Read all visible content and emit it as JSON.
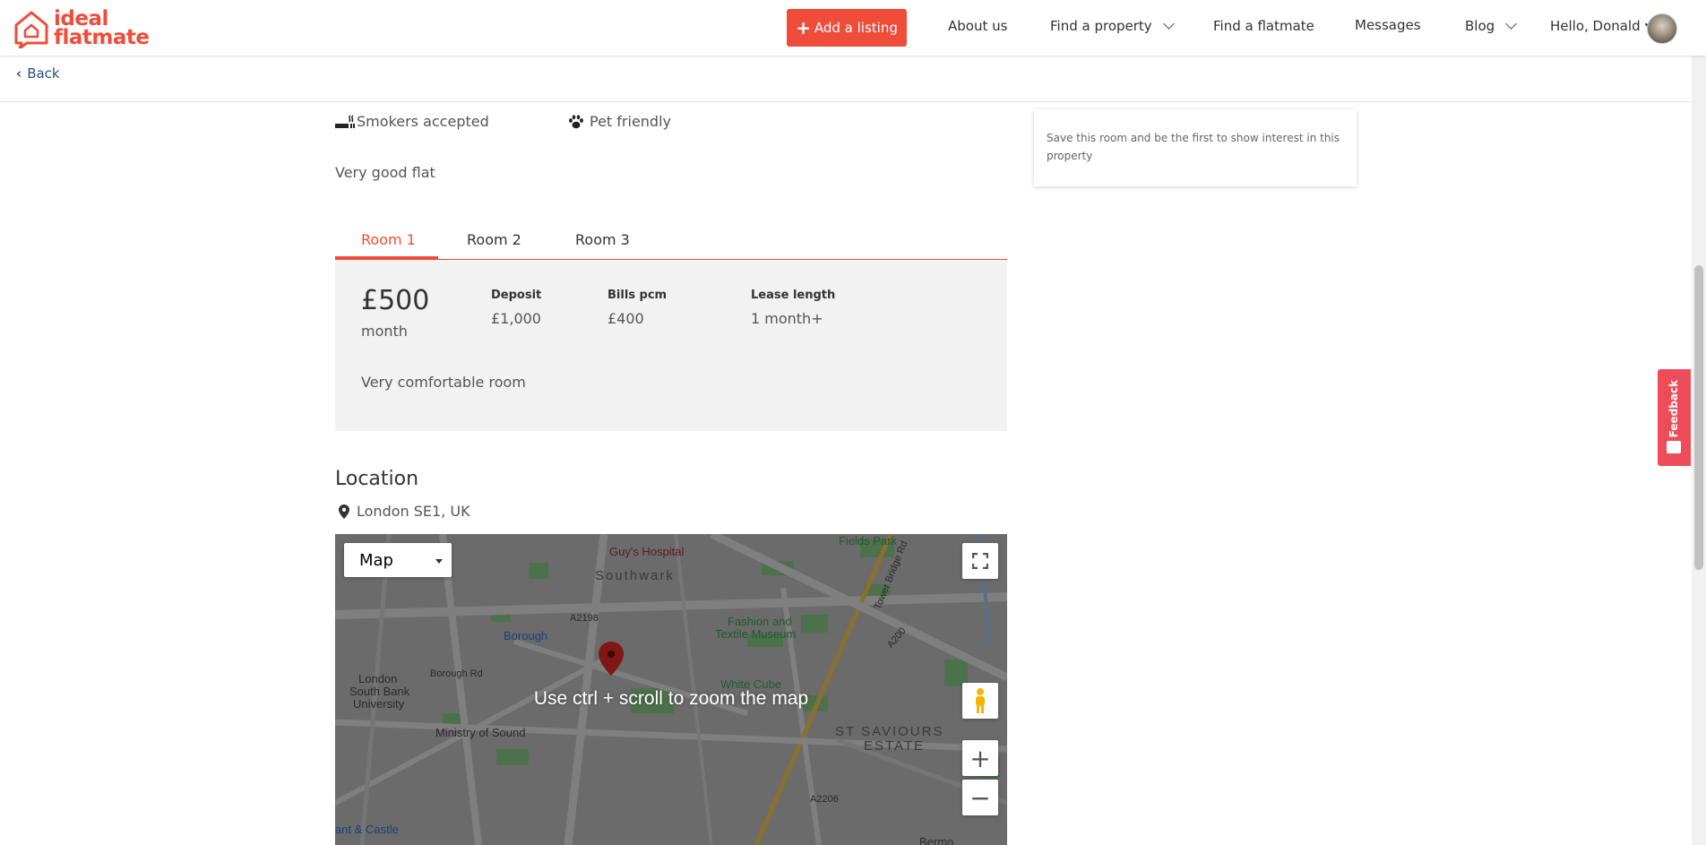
{
  "header": {
    "logo_line1": "ideal",
    "logo_line2": "flatmate",
    "add_listing": "Add a listing",
    "nav": {
      "about": "About us",
      "find_property": "Find a property",
      "find_flatmate": "Find a flatmate",
      "messages": "Messages",
      "blog": "Blog",
      "user": "Hello, Donald"
    }
  },
  "back_label": "Back",
  "features": {
    "smokers": "Smokers accepted",
    "pets": "Pet friendly"
  },
  "description": "Very good flat",
  "tabs": [
    "Room 1",
    "Room 2",
    "Room 3"
  ],
  "active_tab": "Room 1",
  "room": {
    "price": "£500",
    "price_unit": "month",
    "deposit_label": "Deposit",
    "deposit_value": "£1,000",
    "bills_label": "Bills pcm",
    "bills_value": "£400",
    "lease_label": "Lease length",
    "lease_value": "1 month+",
    "description": "Very comfortable room"
  },
  "location": {
    "title": "Location",
    "address": "London SE1, UK"
  },
  "map": {
    "type_select": "Map",
    "hint": "Use ctrl + scroll to zoom the map",
    "labels": {
      "fields_park": "Fields Park",
      "guys_hospital": "Guy's Hospital",
      "southwark": "Southwark",
      "fashion_museum_1": "Fashion and",
      "fashion_museum_2": "Textile Museum",
      "borough": "Borough",
      "white_cube": "White Cube",
      "lsbu_1": "London",
      "lsbu_2": "South Bank",
      "lsbu_3": "University",
      "ministry_of_sound": "Ministry of Sound",
      "st_saviours_1": "ST SAVIOURS",
      "st_saviours_2": "ESTATE",
      "tower_bridge_rd": "Tower Bridge Rd",
      "borough_rd": "Borough Rd",
      "a2198": "A2198",
      "a200": "A200",
      "a2206": "A2206",
      "elephant_castle": "ant & Castle",
      "bermondsey": "Bermo"
    }
  },
  "save_card_text": "Save this room and be the first to show interest in this property",
  "feedback_label": "Feedback",
  "colors": {
    "brand": "#ef4c3a",
    "link": "#2b4c7e",
    "feedback": "#ef4c5a"
  }
}
